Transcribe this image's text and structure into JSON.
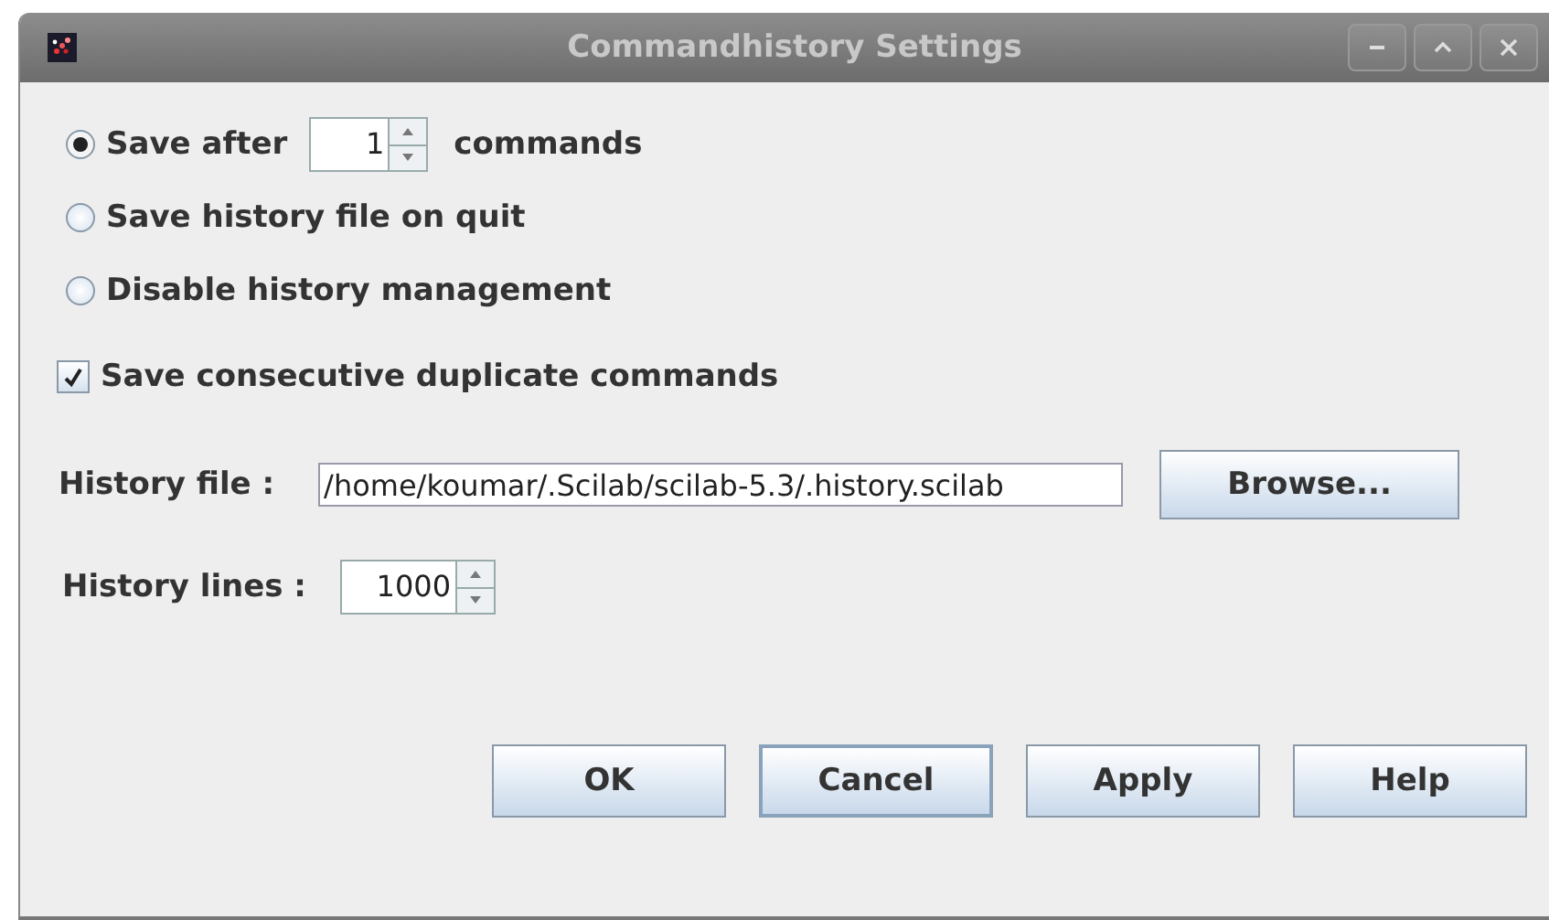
{
  "window": {
    "title": "Commandhistory Settings"
  },
  "save_mode": [
    {
      "label": "Save after",
      "selected": true,
      "spinner": {
        "value": "1"
      },
      "suffix": "commands"
    },
    {
      "label": "Save history file on quit",
      "selected": false
    },
    {
      "label": "Disable history management",
      "selected": false
    }
  ],
  "duplicates": {
    "label": "Save consecutive duplicate commands",
    "checked": true
  },
  "history_file": {
    "label": "History file :",
    "value": "/home/koumar/.Scilab/scilab-5.3/.history.scilab",
    "button": "Browse..."
  },
  "history_lines": {
    "label": "History lines :",
    "value": "1000"
  },
  "buttons": [
    {
      "label": "OK",
      "focused": false
    },
    {
      "label": "Cancel",
      "focused": true
    },
    {
      "label": "Apply",
      "focused": false
    },
    {
      "label": "Help",
      "focused": false
    }
  ]
}
